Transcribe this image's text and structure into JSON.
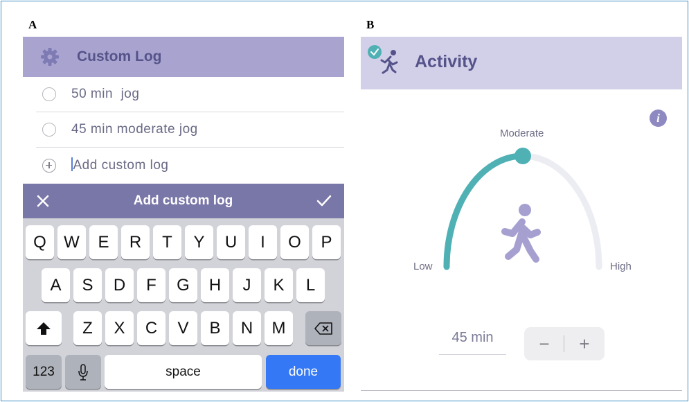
{
  "panels": {
    "a_letter": "A",
    "b_letter": "B"
  },
  "custom_log": {
    "title": "Custom Log",
    "items": [
      {
        "label": "50 min  jog"
      },
      {
        "label": "45 min moderate jog"
      }
    ],
    "add_placeholder": "Add custom log"
  },
  "keyboard": {
    "bar_title": "Add custom log",
    "row1": [
      "Q",
      "W",
      "E",
      "R",
      "T",
      "Y",
      "U",
      "I",
      "O",
      "P"
    ],
    "row2": [
      "A",
      "S",
      "D",
      "F",
      "G",
      "H",
      "J",
      "K",
      "L"
    ],
    "row3": [
      "Z",
      "X",
      "C",
      "V",
      "B",
      "N",
      "M"
    ],
    "numbers_label": "123",
    "space_label": "space",
    "done_label": "done"
  },
  "activity": {
    "title": "Activity",
    "level_selected": "Moderate",
    "level_low": "Low",
    "level_high": "High",
    "level_fraction": 0.5,
    "duration": "45 min",
    "minus": "−",
    "plus": "+",
    "info_symbol": "i"
  },
  "colors": {
    "accent_teal": "#4fb1b4",
    "header_purple": "#a9a4cf",
    "header_light": "#d2d0e8",
    "bar_purple": "#7976a8",
    "figure_purple": "#a6a0d0",
    "done_blue": "#3478f6"
  }
}
